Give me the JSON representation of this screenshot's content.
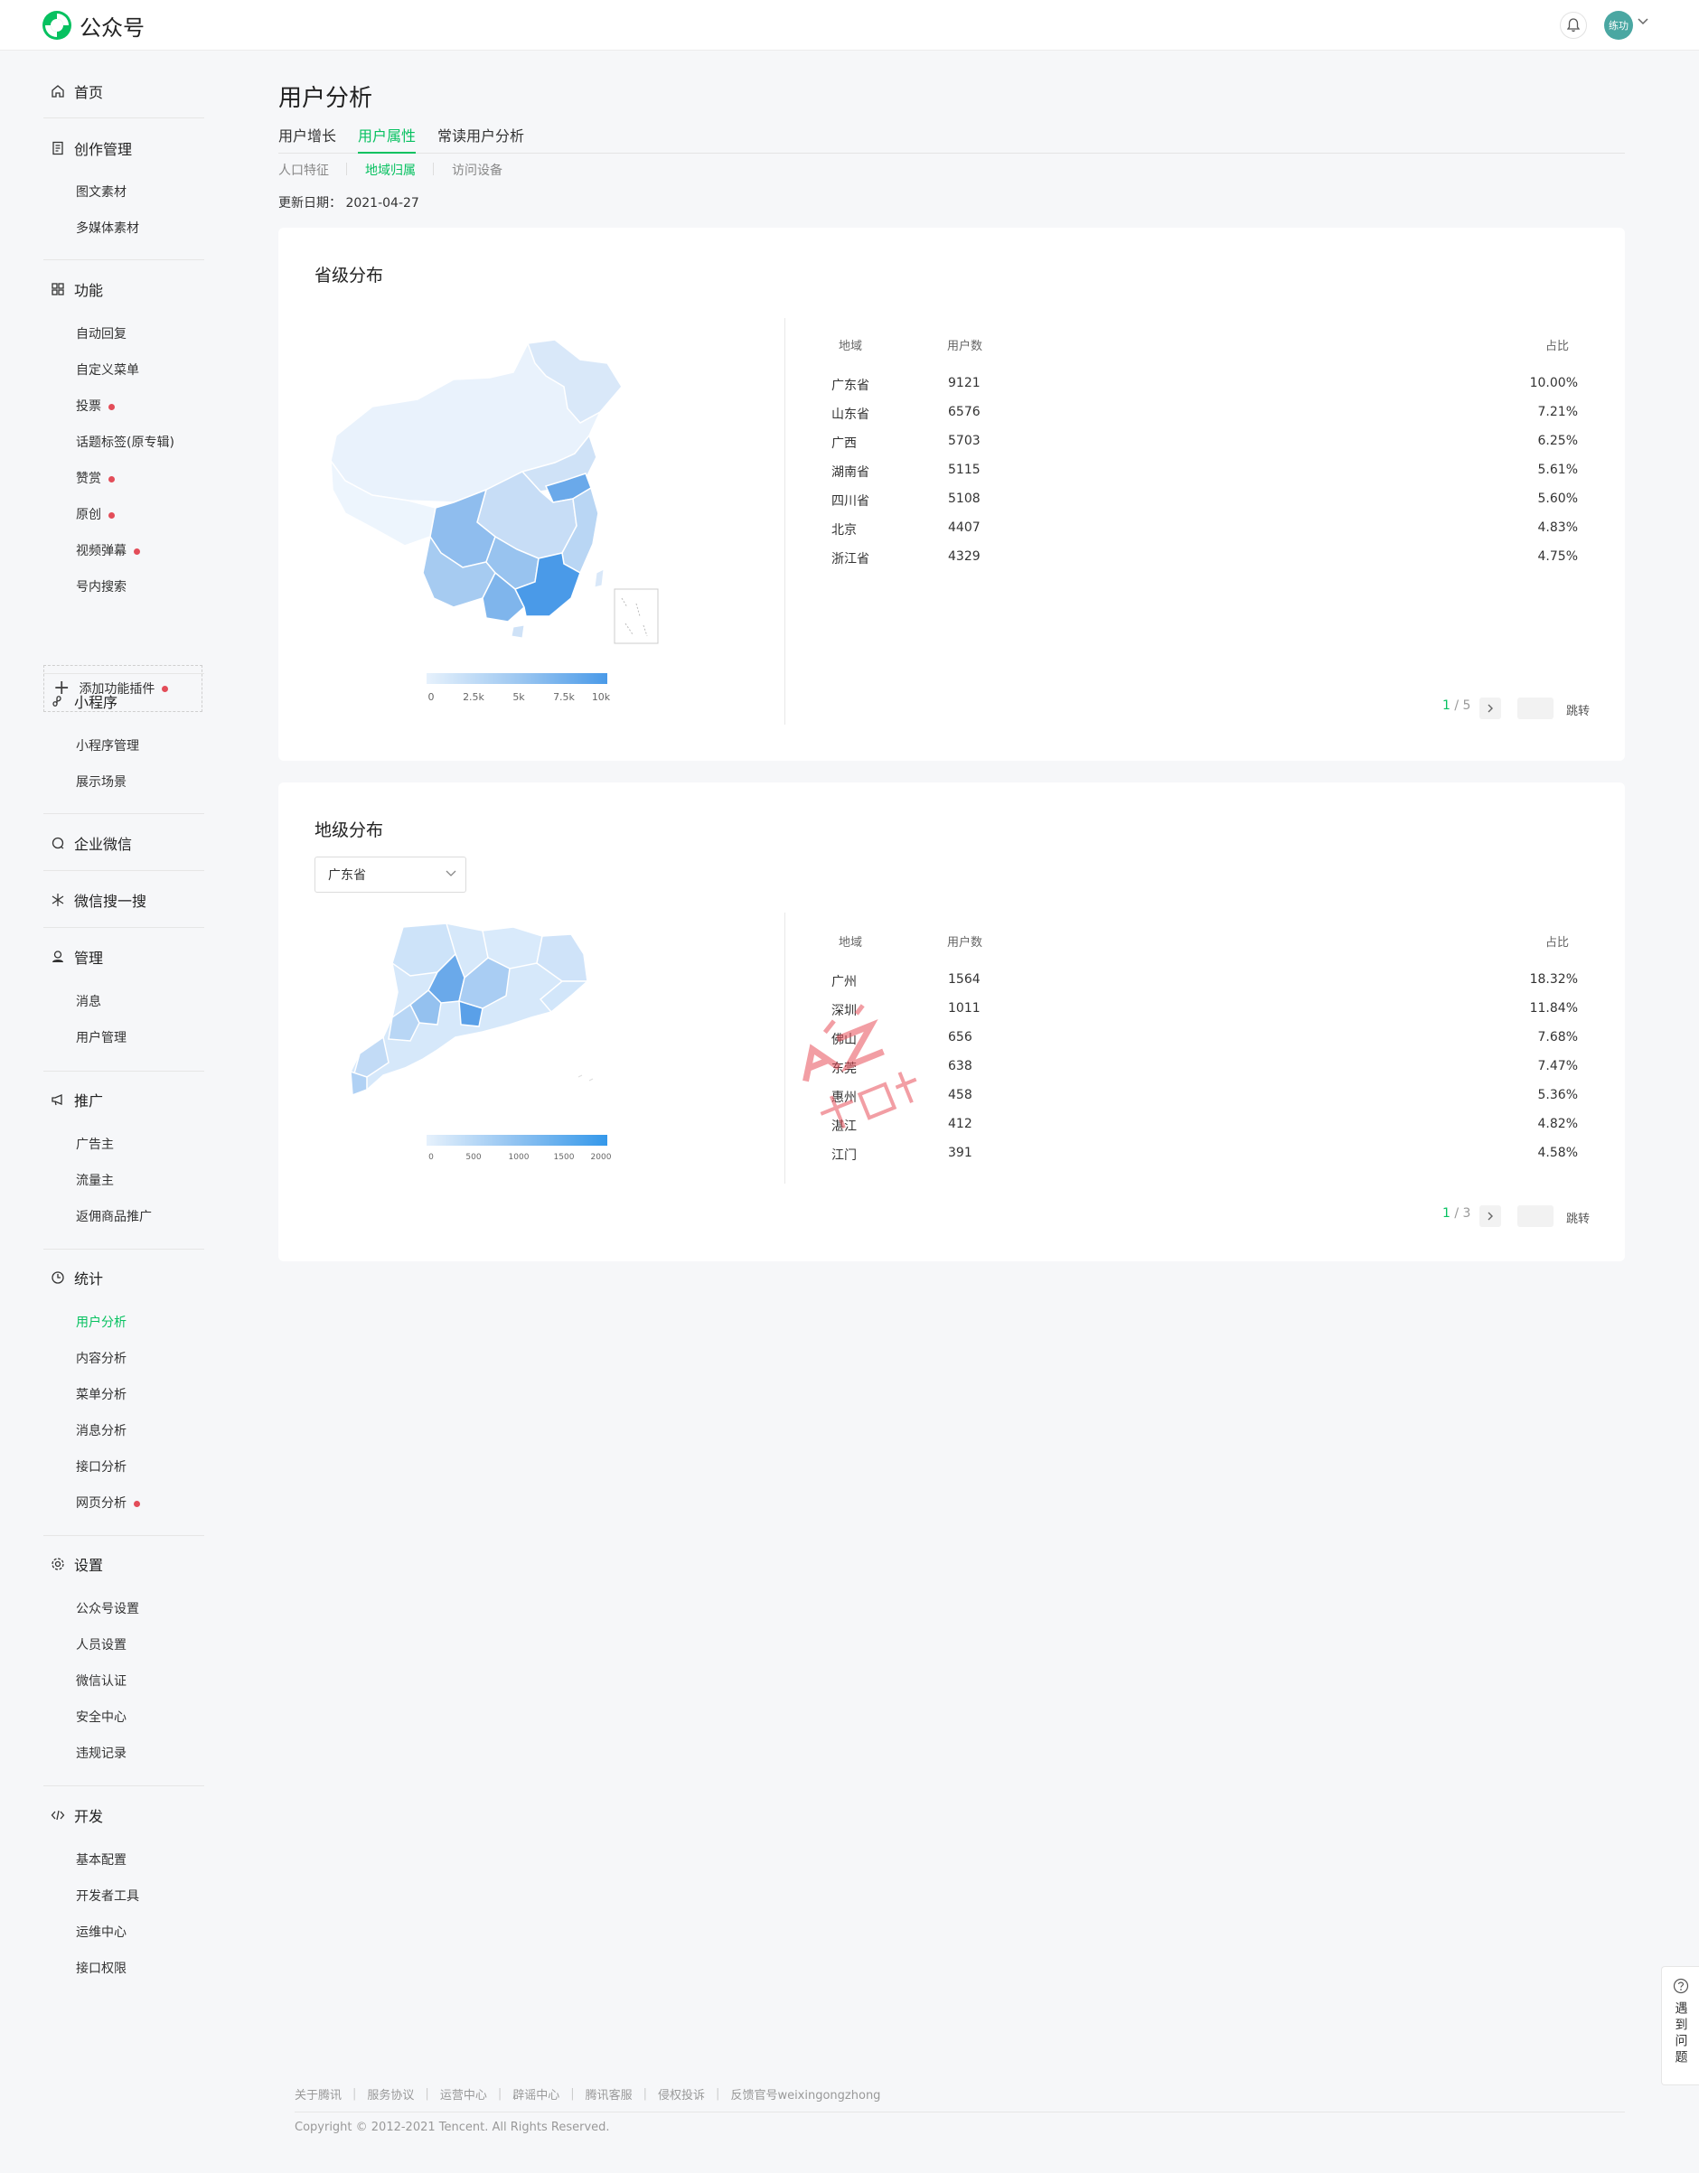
{
  "brand": {
    "name": "公众号",
    "accent": "#07c160"
  },
  "header": {
    "avatar_text": "练功",
    "bell_icon": "bell-icon"
  },
  "sidebar": {
    "home": "首页",
    "create": {
      "label": "创作管理",
      "items": [
        "图文素材",
        "多媒体素材"
      ]
    },
    "features": {
      "label": "功能",
      "items": [
        "自动回复",
        "自定义菜单",
        "投票",
        "话题标签(原专辑)",
        "赞赏",
        "原创",
        "视频弹幕",
        "号内搜索"
      ]
    },
    "add_plugin": "添加功能插件",
    "miniprogram": {
      "label": "小程序",
      "items": [
        "小程序管理",
        "展示场景"
      ]
    },
    "wework": "企业微信",
    "search": "微信搜一搜",
    "manage": {
      "label": "管理",
      "items": [
        "消息",
        "用户管理"
      ]
    },
    "promote": {
      "label": "推广",
      "items": [
        "广告主",
        "流量主",
        "返佣商品推广"
      ]
    },
    "stats": {
      "label": "统计",
      "items": [
        "用户分析",
        "内容分析",
        "菜单分析",
        "消息分析",
        "接口分析",
        "网页分析"
      ]
    },
    "settings": {
      "label": "设置",
      "items": [
        "公众号设置",
        "人员设置",
        "微信认证",
        "安全中心",
        "违规记录"
      ]
    },
    "dev": {
      "label": "开发",
      "items": [
        "基本配置",
        "开发者工具",
        "运维中心",
        "接口权限"
      ]
    }
  },
  "main": {
    "title": "用户分析",
    "tabs": [
      "用户增长",
      "用户属性",
      "常读用户分析"
    ],
    "subtabs": [
      "人口特征",
      "地域归属",
      "访问设备"
    ],
    "update_date": "更新日期： 2021-04-27"
  },
  "province": {
    "title": "省级分布",
    "headers": {
      "region": "地域",
      "users": "用户数",
      "ratio": "占比"
    },
    "rows": [
      {
        "region": "广东省",
        "users": "9121",
        "ratio": "10.00%"
      },
      {
        "region": "山东省",
        "users": "6576",
        "ratio": "7.21%"
      },
      {
        "region": "广西",
        "users": "5703",
        "ratio": "6.25%"
      },
      {
        "region": "湖南省",
        "users": "5115",
        "ratio": "5.61%"
      },
      {
        "region": "四川省",
        "users": "5108",
        "ratio": "5.60%"
      },
      {
        "region": "北京",
        "users": "4407",
        "ratio": "4.83%"
      },
      {
        "region": "浙江省",
        "users": "4329",
        "ratio": "4.75%"
      }
    ],
    "legend": [
      "0",
      "2.5k",
      "5k",
      "7.5k",
      "10k"
    ],
    "pager": {
      "current": "1",
      "total": "/ 5",
      "jump": "跳转"
    }
  },
  "city": {
    "title": "地级分布",
    "select_value": "广东省",
    "headers": {
      "region": "地域",
      "users": "用户数",
      "ratio": "占比"
    },
    "rows": [
      {
        "region": "广州",
        "users": "1564",
        "ratio": "18.32%"
      },
      {
        "region": "深圳",
        "users": "1011",
        "ratio": "11.84%"
      },
      {
        "region": "佛山",
        "users": "656",
        "ratio": "7.68%"
      },
      {
        "region": "东莞",
        "users": "638",
        "ratio": "7.47%"
      },
      {
        "region": "惠州",
        "users": "458",
        "ratio": "5.36%"
      },
      {
        "region": "湛江",
        "users": "412",
        "ratio": "4.82%"
      },
      {
        "region": "江门",
        "users": "391",
        "ratio": "4.58%"
      }
    ],
    "legend": [
      "0",
      "500",
      "1000",
      "1500",
      "2000"
    ],
    "pager": {
      "current": "1",
      "total": "/ 3",
      "jump": "跳转"
    }
  },
  "help": {
    "text": "遇到问题"
  },
  "footer": {
    "links": [
      "关于腾讯",
      "服务协议",
      "运营中心",
      "辟谣中心",
      "腾讯客服",
      "侵权投诉",
      "反馈官号weixingongzhong"
    ],
    "copyright": "Copyright © 2012-2021 Tencent. All Rights Reserved."
  },
  "colors": {
    "accent": "#07c160",
    "map_light": "#e6f1fc",
    "map_dark": "#4a9ae8",
    "badge": "#e34d59"
  }
}
